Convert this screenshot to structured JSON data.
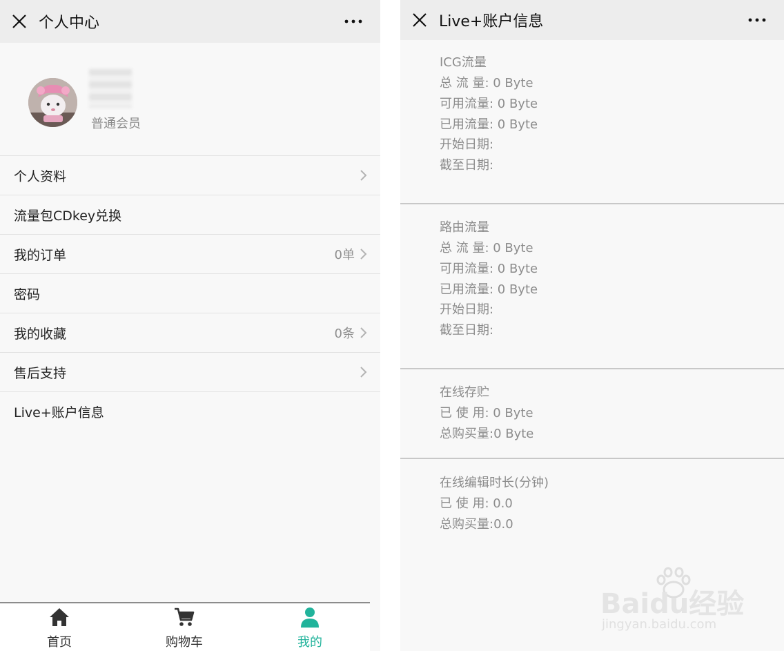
{
  "left_screen": {
    "title": "个人中心",
    "profile": {
      "member_level": "普通会员"
    },
    "menu": [
      {
        "label": "个人资料",
        "value": "",
        "chevron": true
      },
      {
        "label": "流量包CDkey兑换",
        "value": "",
        "chevron": false
      },
      {
        "label": "我的订单",
        "value": "0单",
        "chevron": true
      },
      {
        "label": "密码",
        "value": "",
        "chevron": false
      },
      {
        "label": "我的收藏",
        "value": "0条",
        "chevron": true
      },
      {
        "label": "售后支持",
        "value": "",
        "chevron": true
      },
      {
        "label": "Live+账户信息",
        "value": "",
        "chevron": false
      }
    ],
    "tabbar": {
      "home": "首页",
      "cart": "购物车",
      "me": "我的",
      "active": "me",
      "active_color": "#21b39b"
    }
  },
  "right_screen": {
    "title": "Live+账户信息",
    "sections": [
      {
        "lines": [
          "ICG流量",
          "总 流 量: 0 Byte",
          "可用流量: 0 Byte",
          "已用流量: 0 Byte",
          "开始日期:",
          "截至日期:"
        ]
      },
      {
        "lines": [
          "路由流量",
          "总 流 量: 0 Byte",
          "可用流量: 0 Byte",
          "已用流量: 0 Byte",
          "开始日期:",
          "截至日期:"
        ]
      },
      {
        "lines": [
          "在线存贮",
          "已 使 用: 0 Byte",
          "总购买量:0 Byte"
        ]
      },
      {
        "lines": [
          "在线编辑时长(分钟)",
          "已 使 用: 0.0",
          "总购买量:0.0"
        ]
      }
    ]
  },
  "watermark": {
    "brand": "Baidu经验",
    "url": "jingyan.baidu.com"
  }
}
